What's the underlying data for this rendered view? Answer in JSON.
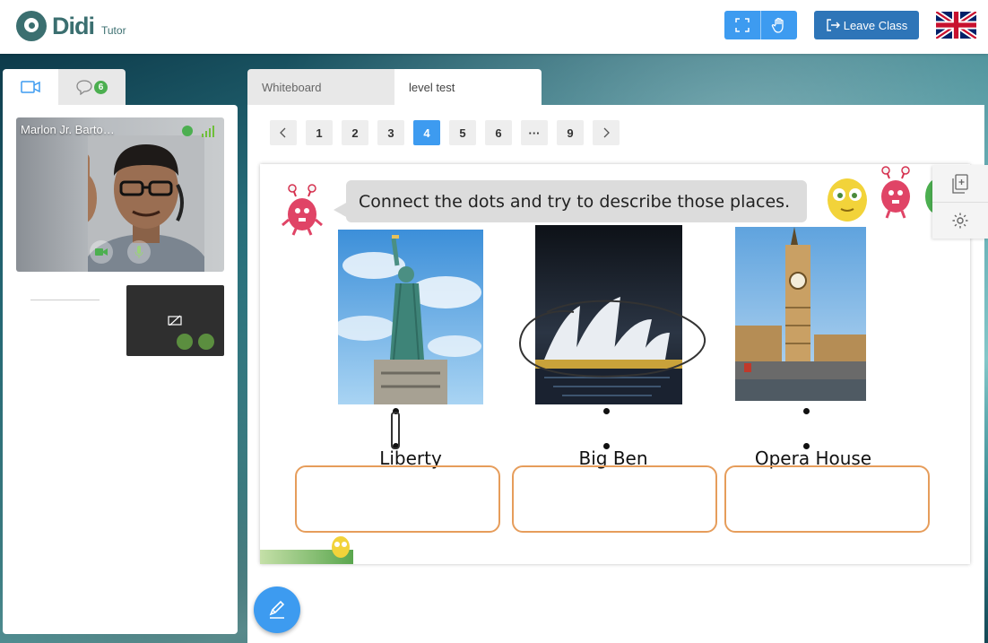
{
  "app": {
    "logo_text": "Didi",
    "logo_sub": "Tutor"
  },
  "header": {
    "fullscreen_icon": "fullscreen-icon",
    "hand_icon": "raise-hand-icon",
    "leave_label": "Leave Class",
    "language_flag": "uk-flag"
  },
  "left": {
    "tabs": [
      {
        "icon": "video-camera-icon"
      },
      {
        "icon": "chat-icon",
        "badge": "6"
      }
    ],
    "participant_name": "Marlon Jr. Barto…"
  },
  "main": {
    "tabs": [
      {
        "label": "Whiteboard"
      },
      {
        "label": "level test"
      }
    ],
    "pages": [
      "1",
      "2",
      "3",
      "4",
      "5",
      "6",
      "···",
      "9"
    ],
    "current_page": "4",
    "prompt": "Connect the dots and try to describe those places.",
    "labels": [
      "Liberty",
      "Big Ben",
      "Opera House"
    ]
  },
  "colors": {
    "accent": "#3d9bf0",
    "leave_button": "#2e75b8",
    "answer_border": "#e69d5b"
  }
}
